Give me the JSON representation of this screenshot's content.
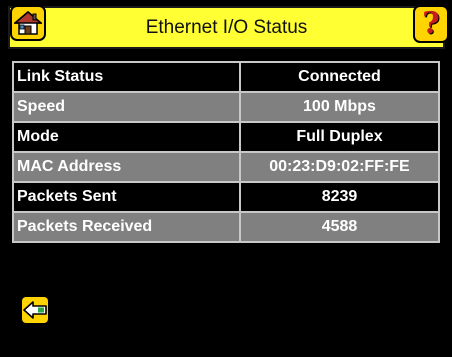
{
  "header": {
    "title": "Ethernet I/O Status",
    "home_icon": "home-icon",
    "help_icon": "help-icon",
    "help_glyph": "?",
    "bar_color": "#ffff33"
  },
  "rows": [
    {
      "label": "Link Status",
      "value": "Connected"
    },
    {
      "label": "Speed",
      "value": "100 Mbps"
    },
    {
      "label": "Mode",
      "value": "Full Duplex"
    },
    {
      "label": "MAC Address",
      "value": "00:23:D9:02:FF:FE"
    },
    {
      "label": "Packets Sent",
      "value": "8239"
    },
    {
      "label": "Packets Received",
      "value": "4588"
    }
  ],
  "footer": {
    "back_icon": "back-arrow-icon",
    "button_color": "#ffd400"
  }
}
